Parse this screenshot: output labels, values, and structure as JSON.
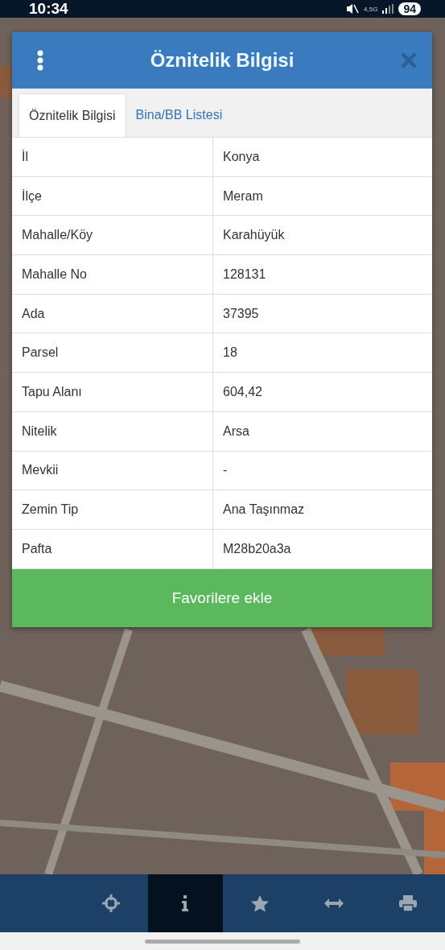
{
  "status_bar": {
    "time": "10:34",
    "network": "4,5G",
    "battery": "94"
  },
  "dialog": {
    "title": "Öznitelik Bilgisi",
    "tabs": [
      {
        "label": "Öznitelik Bilgisi",
        "selected": true
      },
      {
        "label": "Bina/BB Listesi",
        "selected": false
      }
    ],
    "rows": [
      {
        "label": "İl",
        "value": "Konya"
      },
      {
        "label": "İlçe",
        "value": "Meram"
      },
      {
        "label": "Mahalle/Köy",
        "value": "Karahüyük"
      },
      {
        "label": "Mahalle No",
        "value": "128131"
      },
      {
        "label": "Ada",
        "value": "37395"
      },
      {
        "label": "Parsel",
        "value": "18"
      },
      {
        "label": "Tapu Alanı",
        "value": "604,42"
      },
      {
        "label": "Nitelik",
        "value": "Arsa"
      },
      {
        "label": "Mevkii",
        "value": "-"
      },
      {
        "label": "Zemin Tip",
        "value": "Ana Taşınmaz"
      },
      {
        "label": "Pafta",
        "value": "M28b20a3a"
      }
    ],
    "button": "Favorilere ekle"
  },
  "toolbar": [
    {
      "kind": "locate",
      "selected": false
    },
    {
      "kind": "info",
      "selected": true
    },
    {
      "kind": "favorite",
      "selected": false
    },
    {
      "kind": "measure",
      "selected": false
    },
    {
      "kind": "print",
      "selected": false
    }
  ]
}
